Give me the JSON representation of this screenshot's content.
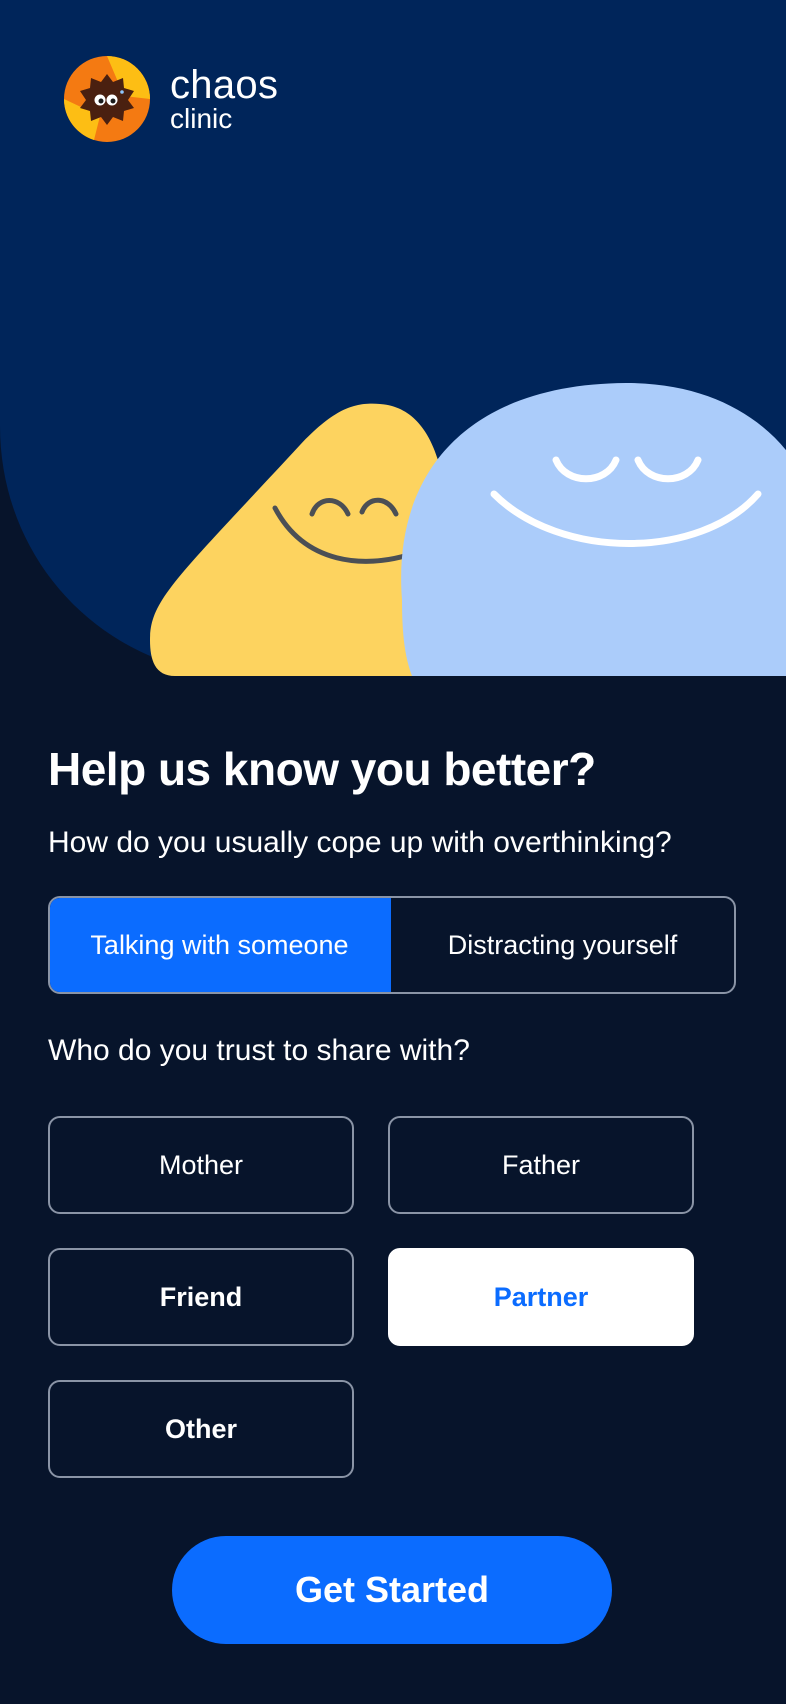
{
  "brand": {
    "name": "chaos",
    "sub": "clinic"
  },
  "colors": {
    "background": "#07142B",
    "hero": "#00255A",
    "accent": "#0B6CFF",
    "yellow": "#FDD35F",
    "blue_blob": "#ABCCFA",
    "logo_orange": "#F47A12",
    "logo_yellow": "#FDBE14"
  },
  "illustration": {
    "icons": [
      "logo-icon",
      "yellow-smiling-blob",
      "blue-smiling-blob"
    ]
  },
  "onboarding": {
    "title": "Help us know you better?",
    "question_cope": "How do you usually cope up with overthinking?",
    "cope_options": [
      {
        "label": "Talking with someone",
        "selected": true
      },
      {
        "label": "Distracting yourself",
        "selected": false
      }
    ],
    "question_trust": "Who do you trust to share with?",
    "trust_options": [
      {
        "label": "Mother",
        "selected": false
      },
      {
        "label": "Father",
        "selected": false
      },
      {
        "label": "Friend",
        "selected": false
      },
      {
        "label": "Partner",
        "selected": true
      },
      {
        "label": "Other",
        "selected": false
      }
    ],
    "cta_label": "Get Started"
  }
}
